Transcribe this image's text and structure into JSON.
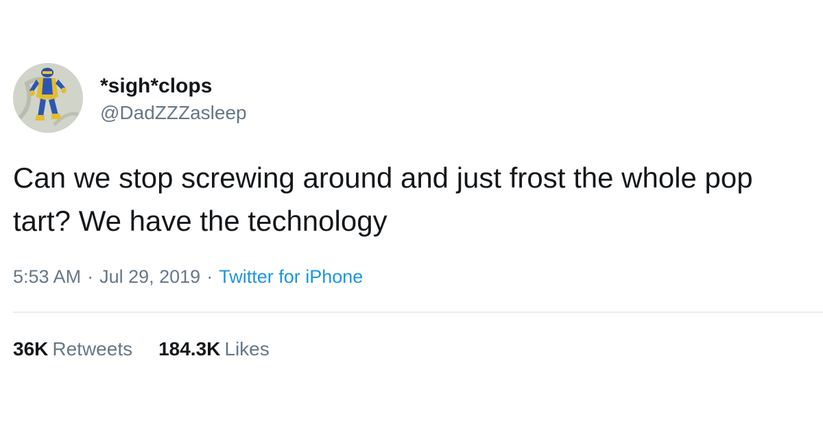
{
  "tweet": {
    "author": {
      "display_name": "*sigh*clops",
      "handle": "@DadZZZasleep",
      "avatar_icon": "cartoon-hero-avatar-icon"
    },
    "text": "Can we stop screwing around and just frost the whole pop tart? We have the technology",
    "time": "5:53 AM",
    "separator": "·",
    "date": "Jul 29, 2019",
    "source": "Twitter for iPhone",
    "stats": {
      "retweets_count": "36K",
      "retweets_label": "Retweets",
      "likes_count": "184.3K",
      "likes_label": "Likes"
    }
  },
  "colors": {
    "text_primary": "#14171a",
    "text_secondary": "#657786",
    "link": "#1b95e0",
    "divider": "#e6ecf0"
  }
}
